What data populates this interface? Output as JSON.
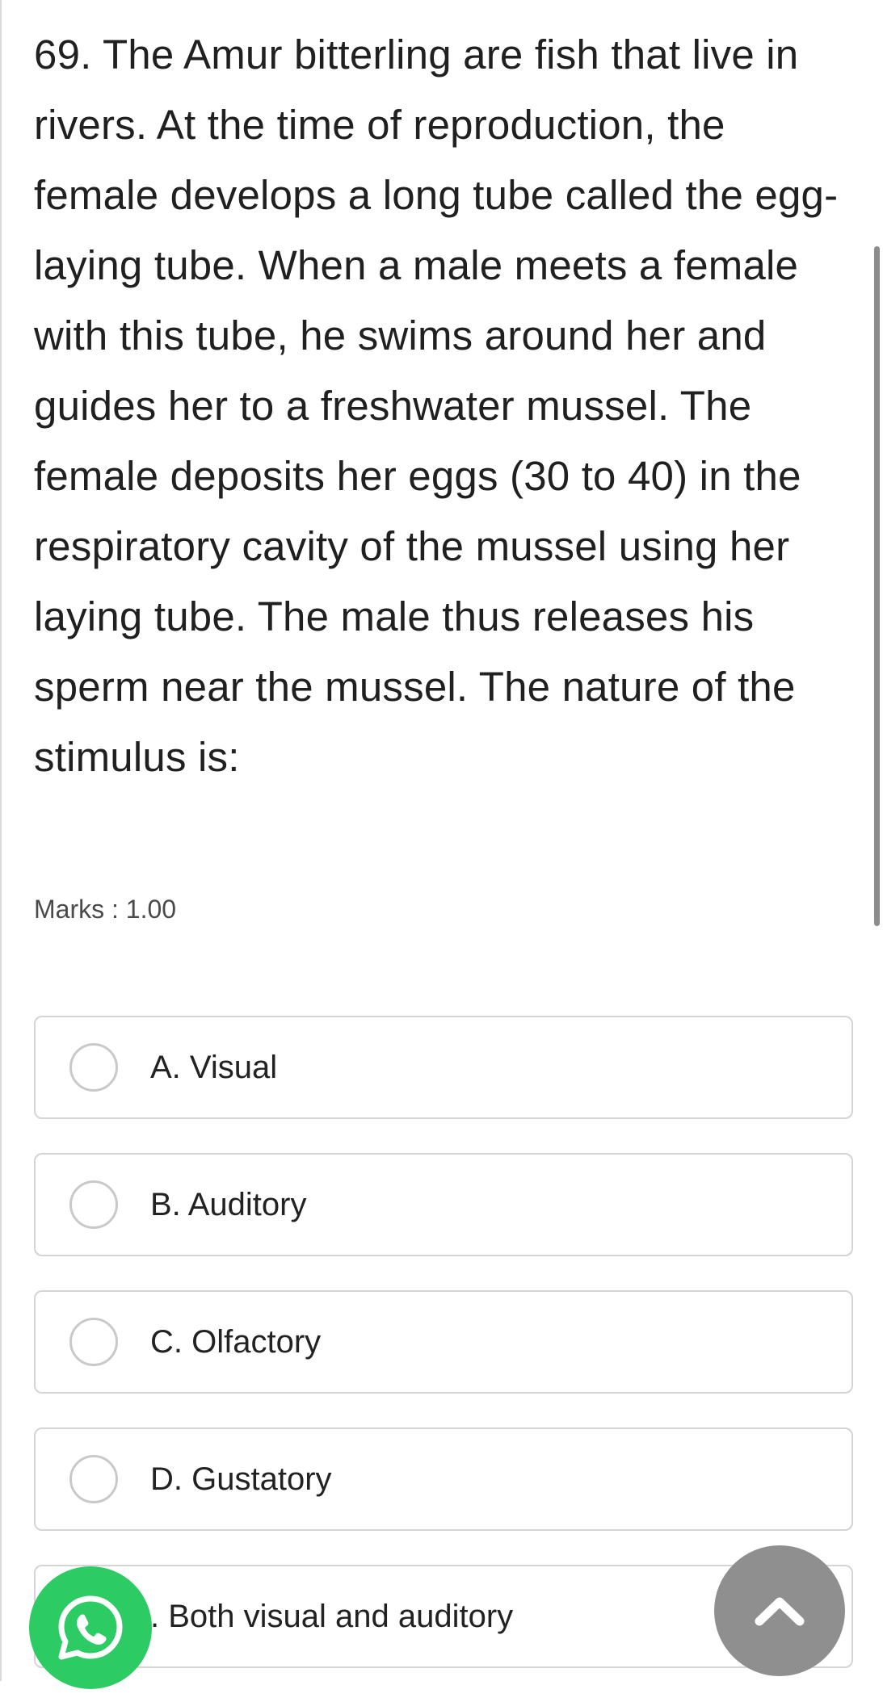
{
  "question": {
    "text": "69. The Amur bitterling are fish that live in rivers. At the time of reproduction, the female develops a long tube called the egg-laying tube. When a male meets a female with this tube, he swims around her and guides her to a freshwater mussel. The female deposits her eggs (30 to 40) in the respiratory cavity of the mussel using her laying tube. The male thus releases his sperm near the mussel. The nature of the stimulus is:",
    "marks": "Marks : 1.00"
  },
  "options": [
    {
      "label": "A. Visual"
    },
    {
      "label": "B. Auditory"
    },
    {
      "label": "C. Olfactory"
    },
    {
      "label": "D. Gustatory"
    },
    {
      "label": ". Both visual and auditory"
    }
  ],
  "floating_buttons": {
    "whatsapp_icon": "whatsapp-icon",
    "scroll_top_icon": "chevron-up-icon"
  },
  "colors": {
    "whatsapp_green": "#2ccb64",
    "scroll_button_gray": "#8f8f8f",
    "option_border": "#d4d4d4"
  }
}
